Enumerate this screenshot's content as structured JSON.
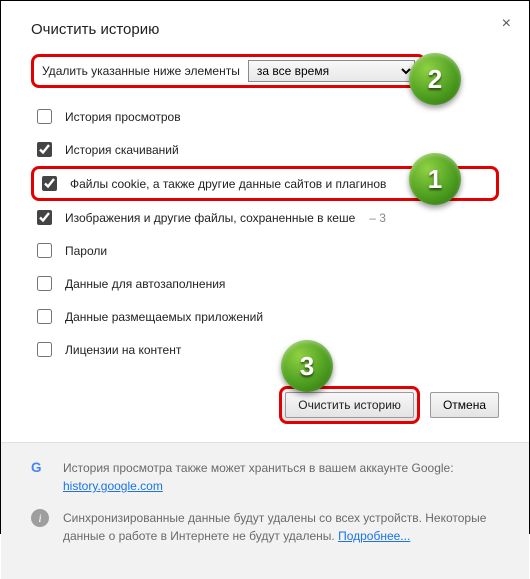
{
  "dialog": {
    "title": "Очистить историю",
    "close_symbol": "×"
  },
  "timerange": {
    "label": "Удалить указанные ниже элементы",
    "selected": "за все время"
  },
  "options": [
    {
      "label": "История просмотров",
      "checked": false,
      "highlighted": false
    },
    {
      "label": "История скачиваний",
      "checked": true,
      "highlighted": false
    },
    {
      "label": "Файлы cookie, а также другие данные сайтов и плагинов",
      "checked": true,
      "highlighted": true
    },
    {
      "label": "Изображения и другие файлы, сохраненные в кеше",
      "checked": true,
      "highlighted": false,
      "suffix": "– 3"
    },
    {
      "label": "Пароли",
      "checked": false,
      "highlighted": false
    },
    {
      "label": "Данные для автозаполнения",
      "checked": false,
      "highlighted": false
    },
    {
      "label": "Данные размещаемых приложений",
      "checked": false,
      "highlighted": false
    },
    {
      "label": "Лицензии на контент",
      "checked": false,
      "highlighted": false
    }
  ],
  "buttons": {
    "clear": "Очистить историю",
    "cancel": "Отмена"
  },
  "footer": {
    "google_text": "История просмотра также может храниться в вашем аккаунте Google:",
    "google_link": "history.google.com",
    "info_text": "Синхронизированные данные будут удалены со всех устройств. Некоторые данные о работе в Интернете не будут удалены.",
    "info_link": "Подробнее..."
  },
  "annotations": {
    "badge1": "1",
    "badge2": "2",
    "badge3": "3"
  }
}
